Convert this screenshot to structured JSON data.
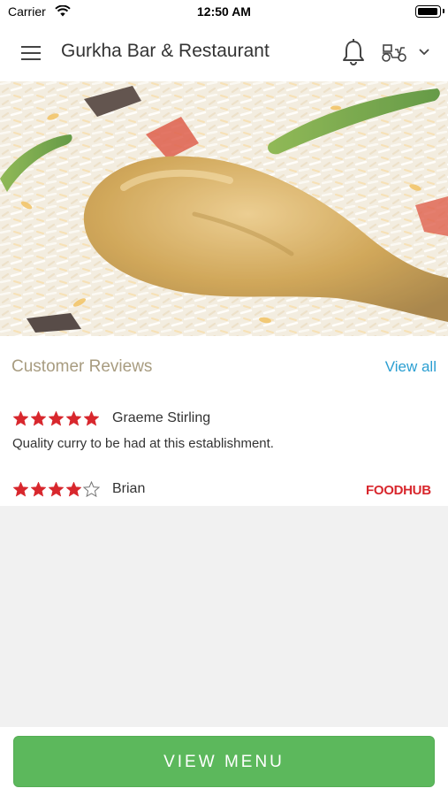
{
  "status_bar": {
    "carrier": "Carrier",
    "time": "12:50 AM",
    "wifi_icon": "wifi-icon",
    "battery_icon": "battery-icon"
  },
  "header": {
    "title": "Gurkha Bar & Restaurant",
    "menu_icon": "hamburger-menu-icon",
    "notification_icon": "bell-icon",
    "delivery_icon": "scooter-icon",
    "dropdown_icon": "chevron-down-icon"
  },
  "hero": {
    "image": "chicken-biryani-photo"
  },
  "reviews": {
    "heading": "Customer Reviews",
    "view_all": "View all",
    "items": [
      {
        "name": "Graeme Stirling",
        "rating": 5,
        "max": 5,
        "text": "Quality curry to be had at this establishment."
      },
      {
        "name": "Brian",
        "rating": 4,
        "max": 5,
        "text": ""
      }
    ],
    "brand": "FOODHUB"
  },
  "footer": {
    "button_label": "VIEW MENU"
  },
  "colors": {
    "star": "#d8272d",
    "accent_link": "#2b9fd2",
    "heading_muted": "#a89c80",
    "primary_button": "#5cb85c",
    "brand": "#d8272d"
  }
}
